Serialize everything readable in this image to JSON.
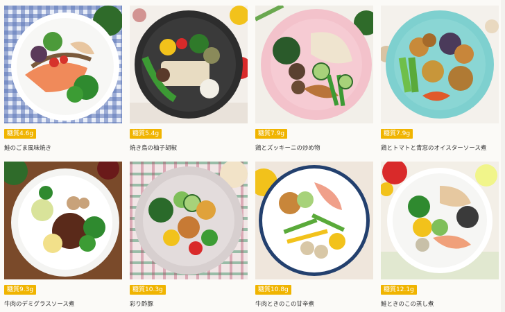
{
  "products": [
    {
      "carb": "糖質4.6g",
      "name": "鮭のごま風味焼き"
    },
    {
      "carb": "糖質5.4g",
      "name": "焼き鳥の柚子胡椒"
    },
    {
      "carb": "糖質7.9g",
      "name": "鶏とズッキーニの炒め物"
    },
    {
      "carb": "糖質7.9g",
      "name": "鶏とトマトと青窓のオイスターソース煮"
    },
    {
      "carb": "糖質9.3g",
      "name": "牛肉のデミグラスソース煮"
    },
    {
      "carb": "糖質10.3g",
      "name": "彩り酢豚"
    },
    {
      "carb": "糖質10.8g",
      "name": "牛肉ときのこの甘辛煮"
    },
    {
      "carb": "糖質12.1g",
      "name": "鮭ときのこの蒸し煮"
    }
  ],
  "colors": {
    "badge": "#f0b400",
    "text": "#333333"
  }
}
